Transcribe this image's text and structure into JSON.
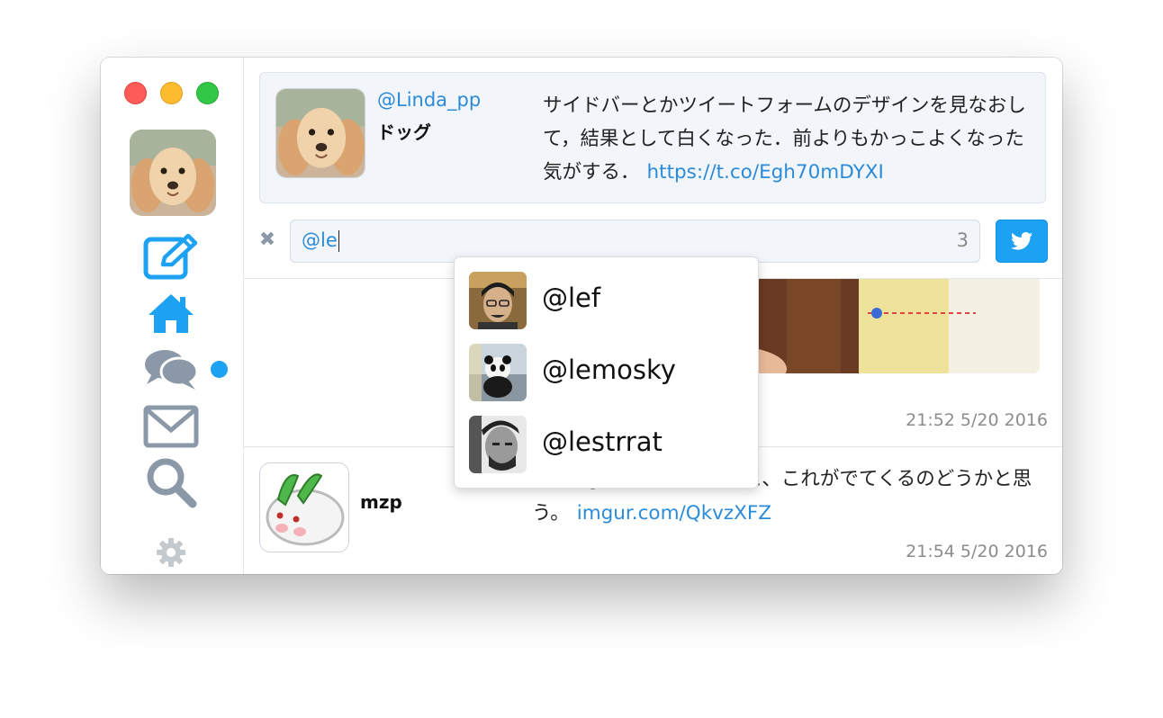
{
  "window": {
    "traffic_lights": [
      "close",
      "minimize",
      "maximize"
    ]
  },
  "sidebar": {
    "items": [
      {
        "icon": "compose-icon",
        "color": "#1da1f2"
      },
      {
        "icon": "home-icon",
        "color": "#1da1f2"
      },
      {
        "icon": "mentions-icon",
        "color": "#8a98a8",
        "unread": true
      },
      {
        "icon": "messages-icon",
        "color": "#8a98a8"
      },
      {
        "icon": "search-icon",
        "color": "#8a98a8"
      },
      {
        "icon": "settings-icon",
        "color": "#c4c9ce"
      }
    ]
  },
  "quoted_tweet": {
    "handle": "@Linda_pp",
    "name": "ドッグ",
    "text": "サイドバーとかツイートフォームのデザインを見なおして，結果として白くなった．前よりもかっこよくなった気がする．",
    "link": "https://t.co/Egh70mDYXI"
  },
  "compose": {
    "value": "@le",
    "remaining": "3",
    "close_icon": "close-icon",
    "send_icon": "twitter-bird-icon"
  },
  "mention_suggestions": [
    {
      "handle": "@lef"
    },
    {
      "handle": "@lemosky"
    },
    {
      "handle": "@lestrrat"
    }
  ],
  "timeline": [
    {
      "time": "21:52 5/20 2016",
      "has_media": true
    },
    {
      "name": "mzp",
      "text_visible_part": "godoxで検索すると、これがでてくるのどうかと思う。",
      "link": "imgur.com/QkvzXFZ",
      "time": "21:54 5/20 2016"
    }
  ],
  "colors": {
    "accent": "#1da1f2",
    "link": "#2b8bd9",
    "muted": "#8a98a8"
  }
}
